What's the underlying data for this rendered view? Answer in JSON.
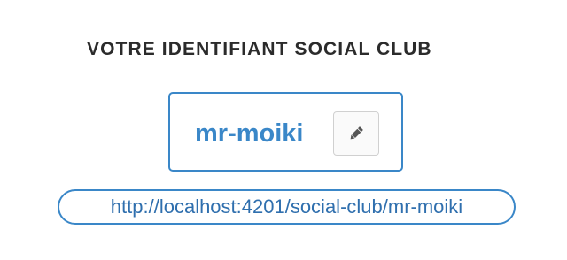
{
  "section": {
    "title": "VOTRE IDENTIFIANT SOCIAL CLUB"
  },
  "identifier": {
    "username": "mr-moiki",
    "edit_icon": "pencil-icon"
  },
  "profile_link": {
    "url": "http://localhost:4201/social-club/mr-moiki"
  },
  "colors": {
    "accent": "#3a87c8",
    "heading": "#2b2b2b",
    "rule": "#dcdcdc"
  }
}
